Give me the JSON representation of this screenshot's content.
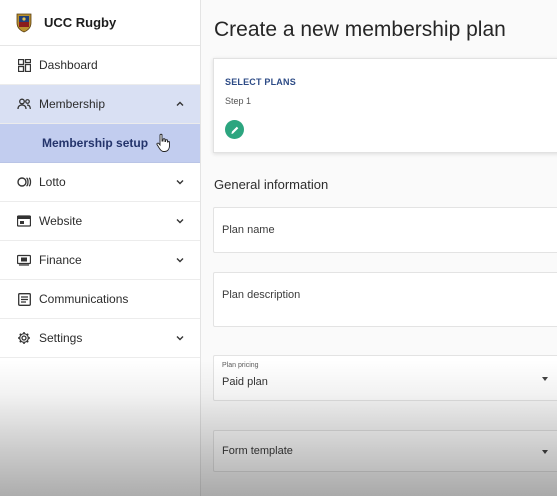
{
  "brand": {
    "name": "UCC Rugby"
  },
  "sidebar": {
    "items": [
      {
        "label": "Dashboard",
        "icon": "dashboard-icon"
      },
      {
        "label": "Membership",
        "icon": "people-icon",
        "expanded": true
      },
      {
        "label": "Membership setup",
        "sub": true,
        "active": true
      },
      {
        "label": "Lotto",
        "icon": "lotto-icon"
      },
      {
        "label": "Website",
        "icon": "website-icon"
      },
      {
        "label": "Finance",
        "icon": "finance-icon"
      },
      {
        "label": "Communications",
        "icon": "communications-icon"
      },
      {
        "label": "Settings",
        "icon": "settings-icon"
      }
    ]
  },
  "main": {
    "title": "Create a new membership plan",
    "plans_card": {
      "label": "SELECT PLANS",
      "step": "Step 1"
    },
    "section_title": "General information",
    "fields": {
      "plan_name": {
        "placeholder": "Plan name"
      },
      "plan_description": {
        "placeholder": "Plan description"
      },
      "plan_pricing": {
        "label": "Plan pricing",
        "value": "Paid plan"
      },
      "form_template": {
        "placeholder": "Form template"
      }
    }
  },
  "colors": {
    "accent": "#2ca57f",
    "nav_active": "#d9e0f3",
    "nav_sub_active": "#c2cdef",
    "link_label": "#2d4b86"
  }
}
